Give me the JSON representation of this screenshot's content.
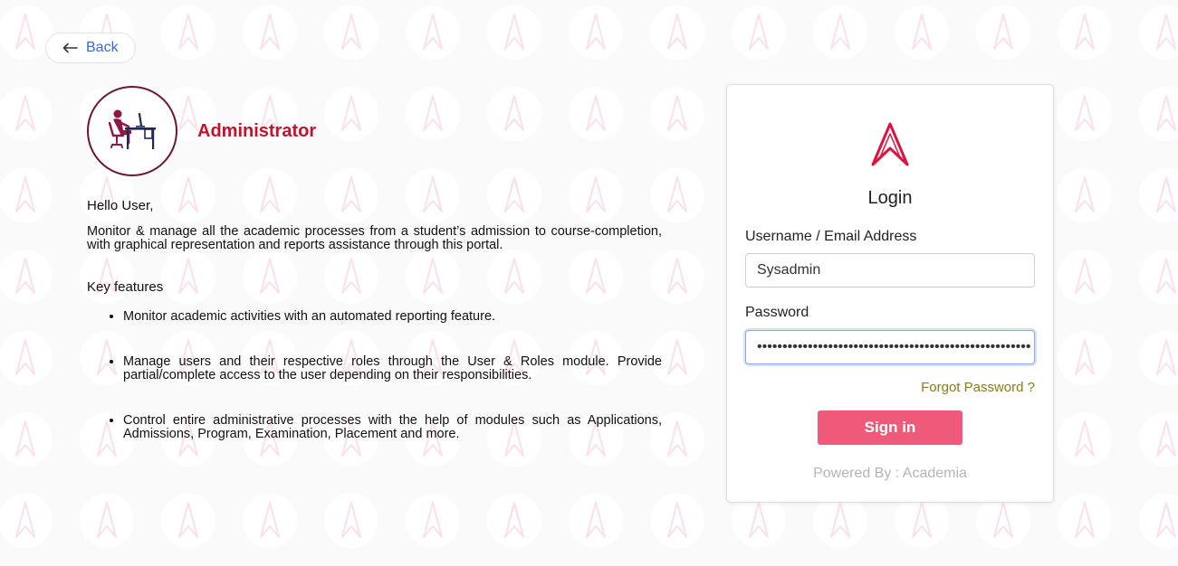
{
  "back_button": {
    "label": "Back",
    "icon": "arrow-left-icon"
  },
  "role": {
    "title": "Administrator",
    "icon": "admin-desk-icon"
  },
  "content": {
    "greeting": "Hello User,",
    "intro": "Monitor & manage all the academic processes from a student’s admission to course-completion, with graphical representation and reports assistance through this portal.",
    "features_heading": "Key features",
    "features": [
      "Monitor academic activities with an automated reporting feature.",
      "Manage users and their respective roles through the User & Roles module. Provide partial/complete access to the user depending on their responsibilities.",
      "Control entire administrative processes with the help of modules such as Applications, Admissions, Program, Examination, Placement and more."
    ]
  },
  "login": {
    "title": "Login",
    "username_label": "Username / Email Address",
    "username_value": "Sysadmin",
    "password_label": "Password",
    "password_value": "••••••••••••••••••••••••••••••••••••••••••••••••••••••",
    "forgot_label": "Forgot Password ?",
    "signin_label": "Sign in",
    "powered_by": "Powered By : Academia",
    "logo_icon": "academia-logo-icon"
  },
  "colors": {
    "accent": "#f05a7a",
    "role_title": "#c4122f",
    "link": "#3b6ad6",
    "forgot": "#8a7b12",
    "logo": "#e0123f"
  }
}
